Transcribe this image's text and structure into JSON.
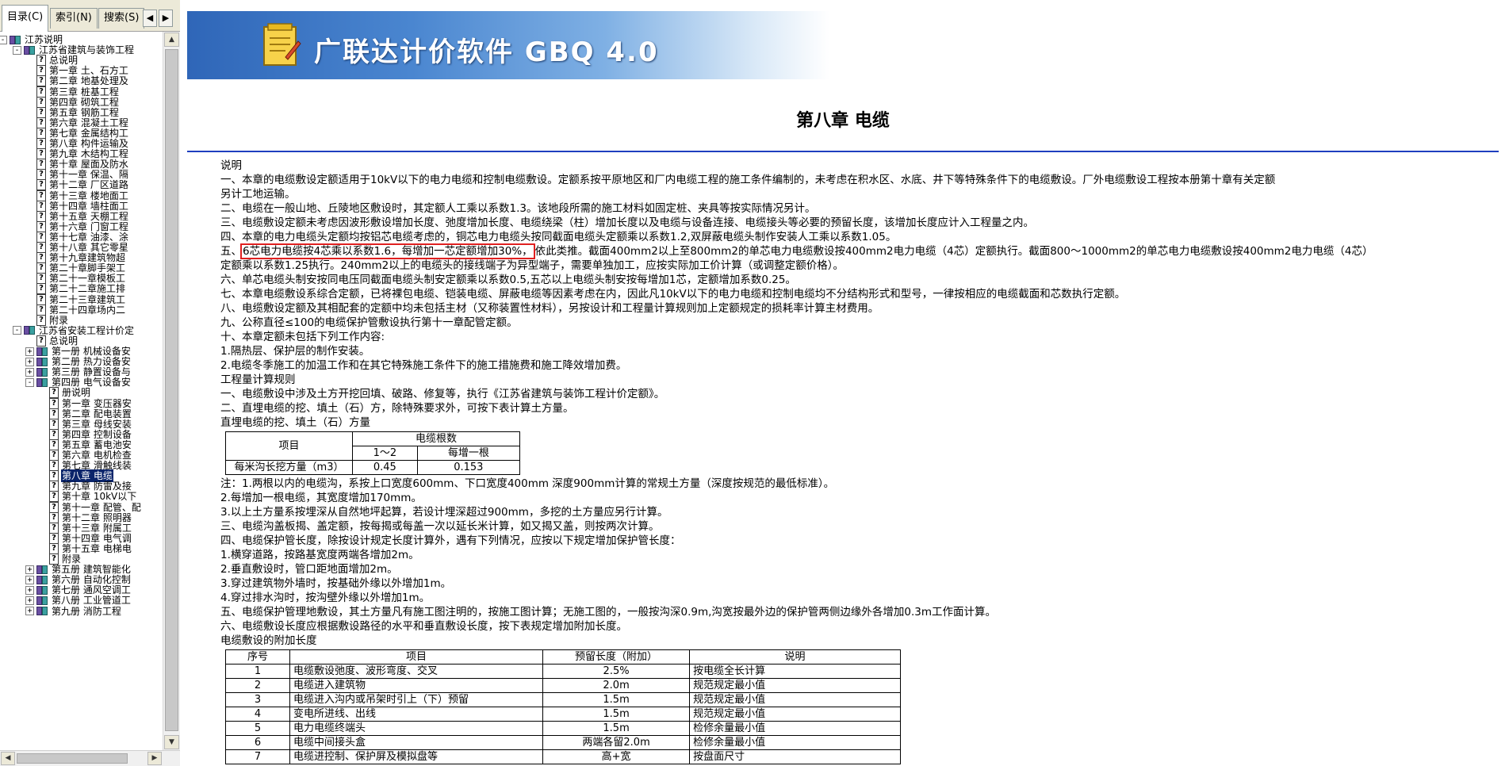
{
  "tabs": [
    {
      "label": "目录(C)",
      "active": true
    },
    {
      "label": "索引(N)",
      "active": false
    },
    {
      "label": "搜索(S)",
      "active": false
    }
  ],
  "tree": [
    {
      "label": "江苏说明",
      "level": 0,
      "kind": "book",
      "expander": "-"
    },
    {
      "label": "江苏省建筑与装饰工程",
      "level": 1,
      "kind": "book",
      "expander": "-"
    },
    {
      "label": "总说明",
      "level": 2,
      "kind": "page"
    },
    {
      "label": "第一章  土、石方工",
      "level": 2,
      "kind": "page"
    },
    {
      "label": "第二章  地基处理及",
      "level": 2,
      "kind": "page"
    },
    {
      "label": "第三章  桩基工程",
      "level": 2,
      "kind": "page"
    },
    {
      "label": "第四章  砌筑工程",
      "level": 2,
      "kind": "page"
    },
    {
      "label": "第五章  钢筋工程",
      "level": 2,
      "kind": "page"
    },
    {
      "label": "第六章  混凝土工程",
      "level": 2,
      "kind": "page"
    },
    {
      "label": "第七章  金属结构工",
      "level": 2,
      "kind": "page"
    },
    {
      "label": "第八章  构件运输及",
      "level": 2,
      "kind": "page"
    },
    {
      "label": "第九章  木结构工程",
      "level": 2,
      "kind": "page"
    },
    {
      "label": "第十章  屋面及防水",
      "level": 2,
      "kind": "page"
    },
    {
      "label": "第十一章  保温、隔",
      "level": 2,
      "kind": "page"
    },
    {
      "label": "第十二章  厂区道路",
      "level": 2,
      "kind": "page"
    },
    {
      "label": "第十三章  楼地面工",
      "level": 2,
      "kind": "page"
    },
    {
      "label": "第十四章  墙柱面工",
      "level": 2,
      "kind": "page"
    },
    {
      "label": "第十五章  天棚工程",
      "level": 2,
      "kind": "page"
    },
    {
      "label": "第十六章  门窗工程",
      "level": 2,
      "kind": "page"
    },
    {
      "label": "第十七章  油漆、涂",
      "level": 2,
      "kind": "page"
    },
    {
      "label": "第十八章  其它零星",
      "level": 2,
      "kind": "page"
    },
    {
      "label": "第十九章建筑物超",
      "level": 2,
      "kind": "page"
    },
    {
      "label": "第二十章脚手架工",
      "level": 2,
      "kind": "page"
    },
    {
      "label": "第二十一章模板工",
      "level": 2,
      "kind": "page"
    },
    {
      "label": "第二十二章施工排",
      "level": 2,
      "kind": "page"
    },
    {
      "label": "第二十三章建筑工",
      "level": 2,
      "kind": "page"
    },
    {
      "label": "第二十四章场内二",
      "level": 2,
      "kind": "page"
    },
    {
      "label": "附录",
      "level": 2,
      "kind": "page"
    },
    {
      "label": "江苏省安装工程计价定",
      "level": 1,
      "kind": "book",
      "expander": "-"
    },
    {
      "label": "总说明",
      "level": 2,
      "kind": "page"
    },
    {
      "label": "第一册  机械设备安",
      "level": 2,
      "kind": "book",
      "expander": "+"
    },
    {
      "label": "第二册  热力设备安",
      "level": 2,
      "kind": "book",
      "expander": "+"
    },
    {
      "label": "第三册  静置设备与",
      "level": 2,
      "kind": "book",
      "expander": "+"
    },
    {
      "label": "第四册  电气设备安",
      "level": 2,
      "kind": "book",
      "expander": "-"
    },
    {
      "label": "册说明",
      "level": 3,
      "kind": "page"
    },
    {
      "label": "第一章  变压器安",
      "level": 3,
      "kind": "page"
    },
    {
      "label": "第二章  配电装置",
      "level": 3,
      "kind": "page"
    },
    {
      "label": "第三章  母线安装",
      "level": 3,
      "kind": "page"
    },
    {
      "label": "第四章  控制设备",
      "level": 3,
      "kind": "page"
    },
    {
      "label": "第五章  蓄电池安",
      "level": 3,
      "kind": "page"
    },
    {
      "label": "第六章  电机检查",
      "level": 3,
      "kind": "page"
    },
    {
      "label": "第七章  滑触线装",
      "level": 3,
      "kind": "page"
    },
    {
      "label": "第八章  电缆",
      "level": 3,
      "kind": "page",
      "selected": true
    },
    {
      "label": "第九章  防雷及接",
      "level": 3,
      "kind": "page"
    },
    {
      "label": "第十章  10kV以下",
      "level": 3,
      "kind": "page"
    },
    {
      "label": "第十一章  配管、配",
      "level": 3,
      "kind": "page"
    },
    {
      "label": "第十二章  照明器",
      "level": 3,
      "kind": "page"
    },
    {
      "label": "第十三章  附属工",
      "level": 3,
      "kind": "page"
    },
    {
      "label": "第十四章  电气调",
      "level": 3,
      "kind": "page"
    },
    {
      "label": "第十五章  电梯电",
      "level": 3,
      "kind": "page"
    },
    {
      "label": "附录",
      "level": 3,
      "kind": "page"
    },
    {
      "label": "第五册  建筑智能化",
      "level": 2,
      "kind": "book",
      "expander": "+"
    },
    {
      "label": "第六册  自动化控制",
      "level": 2,
      "kind": "book",
      "expander": "+"
    },
    {
      "label": "第七册  通风空调工",
      "level": 2,
      "kind": "book",
      "expander": "+"
    },
    {
      "label": "第八册  工业管道工",
      "level": 2,
      "kind": "book",
      "expander": "+"
    },
    {
      "label": "第九册  消防工程",
      "level": 2,
      "kind": "book",
      "expander": "+"
    }
  ],
  "banner": {
    "title": "广联达计价软件 GBQ 4.0"
  },
  "doc": {
    "chapter_title": "第八章  电缆",
    "lines_a": [
      "说明",
      "一、本章的电缆敷设定额适用于10kV以下的电力电缆和控制电缆敷设。定额系按平原地区和厂内电缆工程的施工条件编制的，未考虑在积水区、水底、井下等特殊条件下的电缆敷设。厂外电缆敷设工程按本册第十章有关定额",
      "另计工地运输。",
      "二、电缆在一般山地、丘陵地区敷设时，其定额人工乘以系数1.3。该地段所需的施工材料如固定桩、夹具等按实际情况另计。",
      "三、电缆敷设定额未考虑因波形敷设增加长度、弛度增加长度、电缆绕梁（柱）增加长度以及电缆与设备连接、电缆接头等必要的预留长度，该增加长度应计入工程量之内。",
      "四、本章的电力电缆头定额均按铝芯电缆考虑的，铜芯电力电缆头按同截面电缆头定额乘以系数1.2,双屏蔽电缆头制作安装人工乘以系数1.05。"
    ],
    "line5_prefix": "五、",
    "line5_highlight": "6芯电力电缆按4芯乘以系数1.6，每增加一芯定额增加30%，",
    "line5_rest": "依此类推。截面400mm2以上至800mm2的单芯电力电缆敷设按400mm2电力电缆（4芯）定额执行。截面800～1000mm2的单芯电力电缆敷设按400mm2电力电缆（4芯）",
    "lines_b": [
      "定额乘以系数1.25执行。240mm2以上的电缆头的接线端子为异型端子，需要单独加工，应按实际加工价计算（或调整定额价格）。",
      "六、单芯电缆头制安按同电压同截面电缆头制安定额乘以系数0.5,五芯以上电缆头制安按每增加1芯，定额增加系数0.25。",
      "七、本章电缆敷设系综合定额，已将裸包电缆、铠装电缆、屏蔽电缆等因素考虑在内，因此凡10kV以下的电力电缆和控制电缆均不分结构形式和型号，一律按相应的电缆截面和芯数执行定额。",
      "八、电缆敷设定额及其相配套的定额中均未包括主材（又称装置性材料），另按设计和工程量计算规则加上定额规定的损耗率计算主材费用。",
      "九、公称直径≤100的电缆保护管敷设执行第十一章配管定额。",
      "十、本章定额未包括下列工作内容:",
      "1.隔热层、保护层的制作安装。",
      "2.电缆冬季施工的加温工作和在其它特殊施工条件下的施工措施费和施工降效增加费。",
      "工程量计算规则",
      "一、电缆敷设中涉及土方开挖回填、破路、修复等，执行《江苏省建筑与装饰工程计价定额》。",
      "二、直埋电缆的挖、填土（石）方，除特殊要求外，可按下表计算土方量。",
      "直埋电缆的挖、填土（石）方量"
    ],
    "table1": {
      "col_item": "项目",
      "col_group": "电缆根数",
      "sub1": "1～2",
      "sub2": "每增一根",
      "row_label": "每米沟长挖方量（m3）",
      "v1": "0.45",
      "v2": "0.153"
    },
    "lines_c": [
      "注：1.两根以内的电缆沟，系按上口宽度600mm、下口宽度400mm 深度900mm计算的常规土方量（深度按规范的最低标准）。",
      "2.每增加一根电缆，其宽度增加170mm。",
      "3.以上土方量系按埋深从自然地坪起算，若设计埋深超过900mm，多挖的土方量应另行计算。",
      "三、电缆沟盖板揭、盖定额，按每揭或每盖一次以延长米计算，如又揭又盖，则按两次计算。",
      "四、电缆保护管长度，除按设计规定长度计算外，遇有下列情况，应按以下规定增加保护管长度：",
      "1.横穿道路，按路基宽度两端各增加2m。",
      "2.垂直敷设时，管口距地面增加2m。",
      "3.穿过建筑物外墙时，按基础外缘以外增加1m。",
      "4.穿过排水沟时，按沟壁外缘以外增加1m。",
      "五、电缆保护管理地敷设，其土方量凡有施工图注明的，按施工图计算；无施工图的，一般按沟深0.9m,沟宽按最外边的保护管两侧边缘外各增加0.3m工作面计算。",
      "六、电缆敷设长度应根据敷设路径的水平和垂直敷设长度，按下表规定增加附加长度。",
      "电缆敷设的附加长度"
    ],
    "table2": {
      "headers": [
        "序号",
        "项目",
        "预留长度（附加）",
        "说明"
      ],
      "rows": [
        [
          "1",
          "电缆敷设弛度、波形弯度、交叉",
          "2.5%",
          "按电缆全长计算"
        ],
        [
          "2",
          "电缆进入建筑物",
          "2.0m",
          "规范规定最小值"
        ],
        [
          "3",
          "电缆进入沟内或吊架时引上（下）预留",
          "1.5m",
          "规范规定最小值"
        ],
        [
          "4",
          "变电所进线、出线",
          "1.5m",
          "规范规定最小值"
        ],
        [
          "5",
          "电力电缆终端头",
          "1.5m",
          "检修余量最小值"
        ],
        [
          "6",
          "电缆中间接头盒",
          "两端各留2.0m",
          "检修余量最小值"
        ],
        [
          "7",
          "电缆进控制、保护屏及模拟盘等",
          "高+宽",
          "按盘面尺寸"
        ]
      ]
    }
  }
}
